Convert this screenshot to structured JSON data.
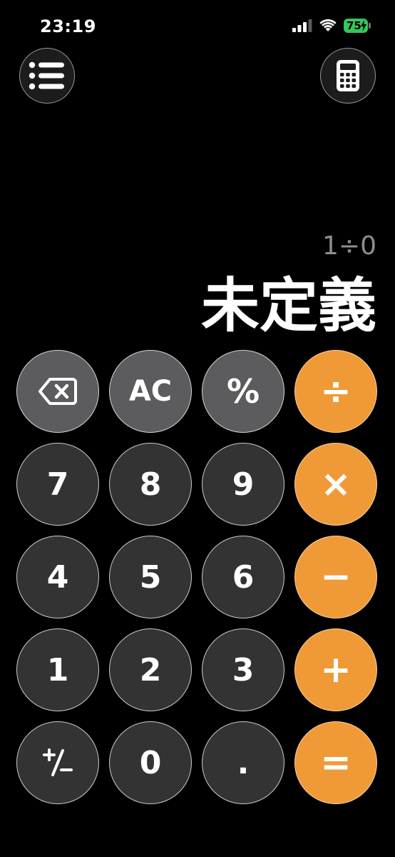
{
  "status_bar": {
    "time": "23:19",
    "battery_level": "75",
    "icons": [
      "cellular-signal-icon",
      "wifi-icon",
      "battery-charging-icon"
    ]
  },
  "toolbar": {
    "left_icon": "list-menu-icon",
    "right_icon": "calculator-icon"
  },
  "display": {
    "expression": "1÷0",
    "result": "未定義"
  },
  "keypad": {
    "row1": {
      "backspace_icon": "backspace-icon",
      "clear": "AC",
      "percent": "%",
      "divide": "÷"
    },
    "row2": {
      "seven": "7",
      "eight": "8",
      "nine": "9",
      "multiply": "×"
    },
    "row3": {
      "four": "4",
      "five": "5",
      "six": "6",
      "minus": "−"
    },
    "row4": {
      "one": "1",
      "two": "2",
      "three": "3",
      "plus": "+"
    },
    "row5": {
      "sign_icon": "plus-minus-icon",
      "zero": "0",
      "decimal": ".",
      "equals": "="
    }
  },
  "colors": {
    "background": "#000000",
    "operator_key": "#f09a37",
    "function_key": "#5c5c5e",
    "number_key": "#333333",
    "battery": "#34c759",
    "expression_text": "#8e8e93"
  }
}
